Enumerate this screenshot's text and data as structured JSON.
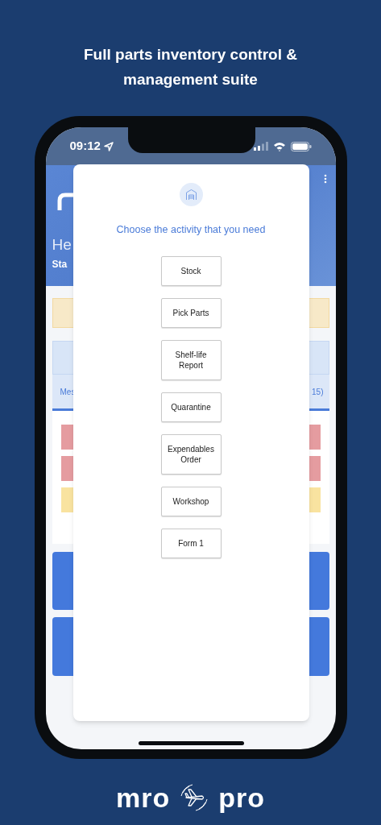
{
  "headline": "Full parts inventory control & management suite",
  "status_bar": {
    "time": "09:12"
  },
  "background_app": {
    "greeting": "He",
    "subtitle": "Sta",
    "tab_left": "Mes",
    "tab_right": "15)",
    "alerts": [
      {
        "color": "#e59ca0"
      },
      {
        "color": "#e59ca0"
      },
      {
        "color": "#f9e3a0"
      }
    ]
  },
  "dialog": {
    "title": "Choose the activity that you need",
    "options": [
      "Stock",
      "Pick Parts",
      "Shelf-life Report",
      "Quarantine",
      "Expendables Order",
      "Workshop",
      "Form 1"
    ]
  },
  "brand": {
    "left": "mro",
    "right": "pro"
  }
}
